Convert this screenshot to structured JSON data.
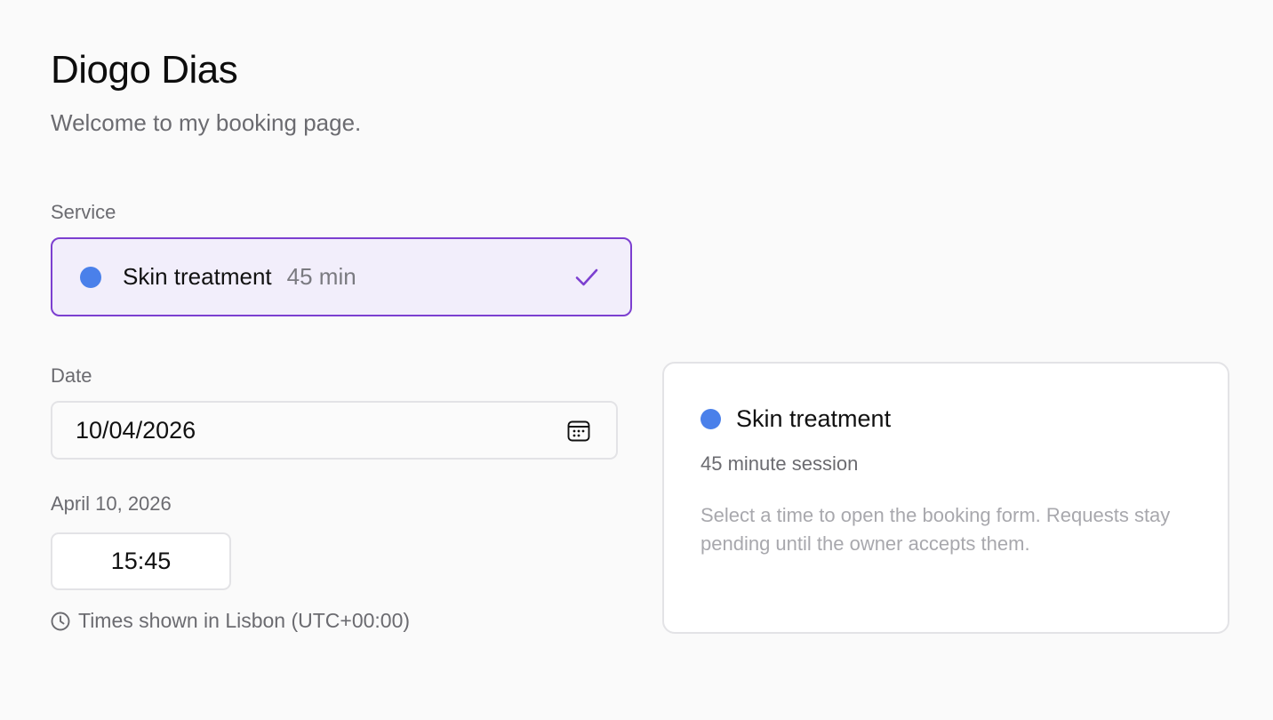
{
  "header": {
    "owner_name": "Diogo Dias",
    "welcome": "Welcome to my booking page."
  },
  "service": {
    "label": "Service",
    "selected": {
      "name": "Skin treatment",
      "duration": "45 min",
      "color": "#4a80ea"
    },
    "accent_color": "#7c3fd0"
  },
  "date": {
    "label": "Date",
    "value": "10/04/2026"
  },
  "slots": {
    "day_label": "April 10, 2026",
    "times": [
      "15:45"
    ]
  },
  "timezone_note": "Times shown in Lisbon (UTC+00:00)",
  "summary": {
    "title": "Skin treatment",
    "duration": "45 minute session",
    "hint": "Select a time to open the booking form. Requests stay pending until the owner accepts them."
  }
}
